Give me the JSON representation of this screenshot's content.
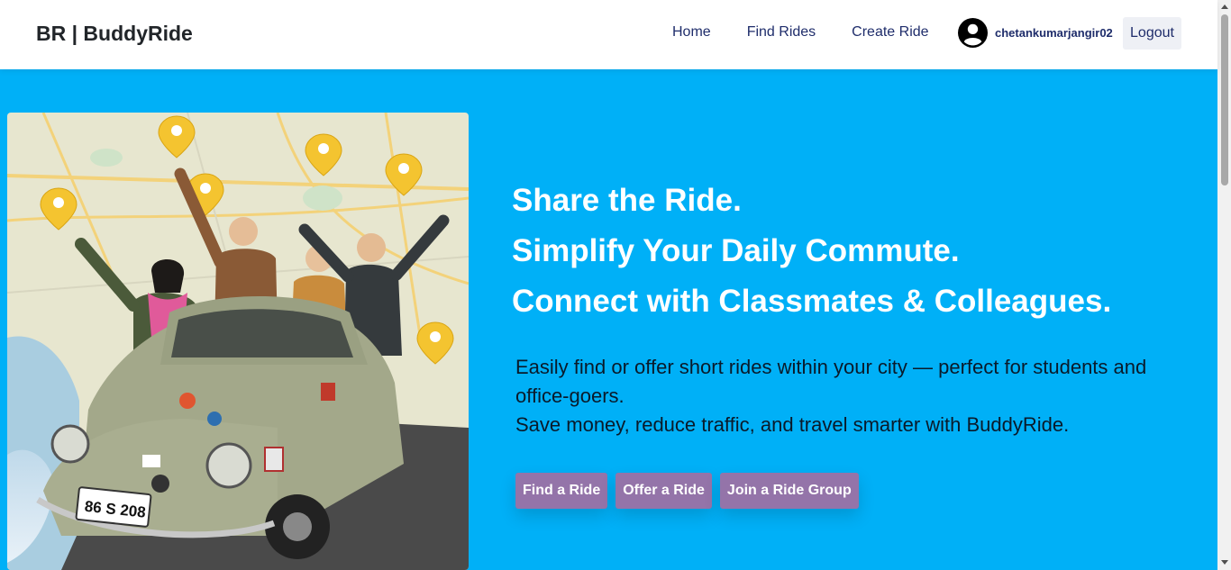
{
  "navbar": {
    "brand": "BR | BuddyRide",
    "links": [
      "Home",
      "Find Rides",
      "Create Ride"
    ],
    "username": "chetankumarjangir02",
    "logout_label": "Logout"
  },
  "hero": {
    "headlines": [
      "Share the Ride.",
      "Simplify Your Daily Commute.",
      "Connect with Classmates & Colleagues."
    ],
    "description_lines": [
      "Easily find or offer short rides within your city — perfect for students and office-goers.",
      "Save money, reduce traffic, and travel smarter with BuddyRide."
    ],
    "buttons": [
      "Find a Ride",
      "Offer a Ride",
      "Join a Ride Group"
    ],
    "image_plate": "86 S 208"
  },
  "colors": {
    "hero_background": "#00b0f7",
    "button_background": "#9474a9",
    "nav_link": "#1f2d6b"
  }
}
